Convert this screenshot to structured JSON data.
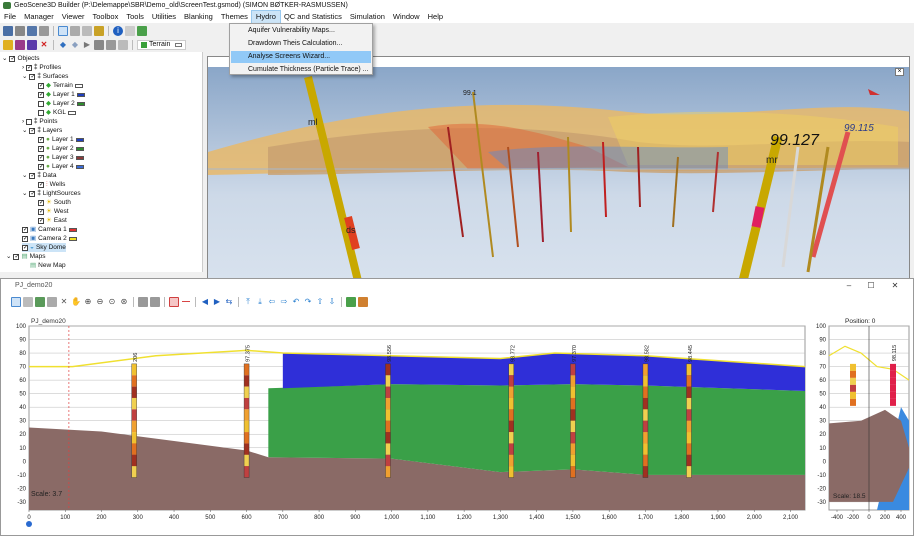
{
  "window": {
    "title": "GeoScene3D Builder (P:\\Delemappe\\SBR\\Demo_old\\ScreenTest.gsmod) (SIMON BØTKER-RASMUSSEN)"
  },
  "menubar": [
    "File",
    "Manager",
    "Viewer",
    "Toolbox",
    "Tools",
    "Utilities",
    "Blanking",
    "Themes",
    "Hydro",
    "QC and Statistics",
    "Simulation",
    "Window",
    "Help"
  ],
  "hydro_menu": [
    "Aquifer Vulnerability Maps...",
    "Drawdown Theis Calculation...",
    "Analyse Screens Wizard...",
    "Cumulate Thickness (Particle Trace) ..."
  ],
  "toolbar": {
    "layer_selector": "Terrain"
  },
  "tree": {
    "root": "Objects",
    "profiles": "Profiles",
    "surfaces": {
      "label": "Surfaces",
      "items": [
        {
          "label": "Terrain",
          "color": "#ffffff"
        },
        {
          "label": "Layer 1",
          "color": "#1f3fbf"
        },
        {
          "label": "Layer 2",
          "color": "#2e8b2e"
        },
        {
          "label": "KGL",
          "color": "#ffffff"
        }
      ]
    },
    "points": "Points",
    "layers": {
      "label": "Layers",
      "items": [
        {
          "label": "Layer 1",
          "color": "#1f3fbf"
        },
        {
          "label": "Layer 2",
          "color": "#2e8b2e"
        },
        {
          "label": "Layer 3",
          "color": "#8b3a3a"
        },
        {
          "label": "Layer 4",
          "color": "#3a6bd8"
        }
      ]
    },
    "data": {
      "label": "Data",
      "wells": "Wells"
    },
    "lightsources": {
      "label": "LightSources",
      "items": [
        "South",
        "West",
        "East"
      ]
    },
    "camera1": {
      "label": "Camera 1",
      "color": "#e03030"
    },
    "camera2": {
      "label": "Camera 2",
      "color": "#f0e020"
    },
    "skydome": "Sky Dome",
    "maps": {
      "label": "Maps",
      "newmap": "New Map"
    }
  },
  "view3d": {
    "labels": [
      "99.127",
      "99.115",
      "mr",
      "ds",
      "ml",
      "99.1"
    ]
  },
  "profile_window": {
    "title": "PJ_demo20",
    "chart_label": "PJ_demo20",
    "scale_label": "Scale: 3.7",
    "side_position": "Position: 0",
    "side_scale": "Scale: 18.5",
    "wells": [
      {
        "id": "206",
        "x": 290
      },
      {
        "id": "97.375",
        "x": 600
      },
      {
        "id": "98.556",
        "x": 990
      },
      {
        "id": "98.772",
        "x": 1330
      },
      {
        "id": "97.370",
        "x": 1500
      },
      {
        "id": "98.582",
        "x": 1700
      },
      {
        "id": "98.445",
        "x": 1820
      }
    ],
    "side_well": {
      "id": "98.115",
      "x": 300
    }
  },
  "chart_data": [
    {
      "type": "area",
      "title": "",
      "x_ticks": [
        "0",
        "100",
        "200",
        "300",
        "400",
        "500",
        "600",
        "700",
        "800",
        "900",
        "1,000",
        "1,100",
        "1,200",
        "1,300",
        "1,400",
        "1,500",
        "1,600",
        "1,700",
        "1,800",
        "1,900",
        "2,000",
        "2,100"
      ],
      "y_ticks": [
        "100",
        "90",
        "80",
        "70",
        "60",
        "50",
        "40",
        "30",
        "20",
        "10",
        "0",
        "-10",
        "-20",
        "-30"
      ],
      "xlim": [
        0,
        2140
      ],
      "ylim": [
        -36,
        100
      ],
      "grid": true,
      "series": [
        {
          "x": [
            0,
            120,
            350,
            600,
            700,
            1000,
            1300,
            1450,
            1700,
            2140
          ],
          "values": [
            70,
            70,
            78,
            82,
            80,
            78,
            76,
            80,
            78,
            70
          ]
        },
        {
          "x": [
            0,
            200,
            400,
            600,
            660,
            1000,
            1300,
            1500,
            1700,
            2140
          ],
          "values": [
            25,
            22,
            15,
            8,
            3,
            2,
            -8,
            -6,
            -10,
            -10
          ]
        }
      ]
    },
    {
      "type": "area",
      "x_ticks": [
        "-400",
        "-200",
        "0",
        "200",
        "400"
      ],
      "y_ticks": [
        "100",
        "90",
        "80",
        "70",
        "60",
        "50",
        "40",
        "30",
        "20",
        "10",
        "0",
        "-10",
        "-20",
        "-30"
      ],
      "xlim": [
        -500,
        500
      ],
      "ylim": [
        -36,
        100
      ],
      "grid": true,
      "series": [
        {
          "x": [
            -500,
            -300,
            -100,
            100,
            300,
            500
          ],
          "values": [
            78,
            85,
            80,
            70,
            68,
            60
          ]
        }
      ]
    }
  ]
}
